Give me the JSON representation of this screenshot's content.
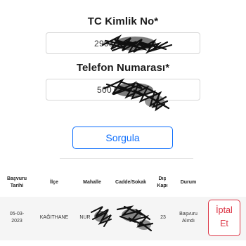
{
  "form": {
    "tc_label": "TC Kimlik No*",
    "tc_value": "2993",
    "phone_label": "Telefon Numarası*",
    "phone_value": "500",
    "submit_label": "Sorgula"
  },
  "table": {
    "headers": [
      "Başvuru\nTarihi",
      "İlçe",
      "Mahalle",
      "Cadde/Sokak",
      "Dış\nKapı",
      "Durum"
    ],
    "rows": [
      {
        "date": "05-03-\n2023",
        "district": "KAĞITHANE",
        "neighborhood": "NUR",
        "street": "",
        "door": "23",
        "status": "Başvuru\nAlındı",
        "action_label": "İptal\nEt"
      }
    ]
  },
  "colors": {
    "primary": "#0d6efd",
    "danger": "#dc3545",
    "row_background": "#f5f5f5"
  }
}
